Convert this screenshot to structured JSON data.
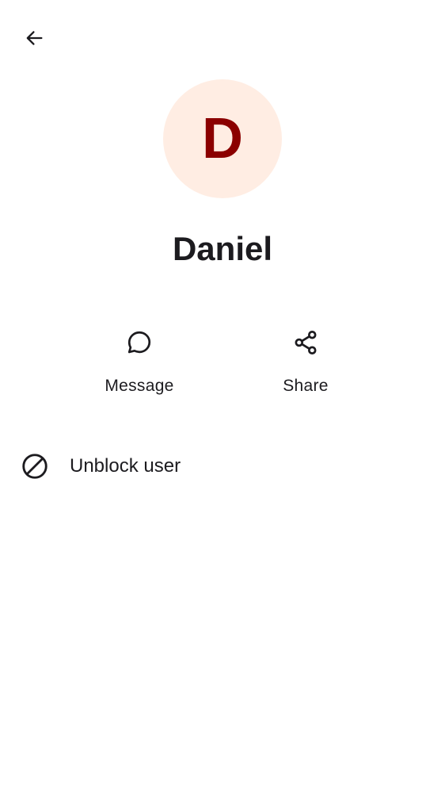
{
  "header": {
    "back_icon": "arrow-back-icon"
  },
  "profile": {
    "avatar_letter": "D",
    "avatar_bg_color": "#ffede3",
    "avatar_letter_color": "#8b0000",
    "name": "Daniel"
  },
  "actions": [
    {
      "label": "Message",
      "icon": "chat-bubble-icon"
    },
    {
      "label": "Share",
      "icon": "share-icon"
    }
  ],
  "options": [
    {
      "label": "Unblock user",
      "icon": "block-icon"
    }
  ]
}
